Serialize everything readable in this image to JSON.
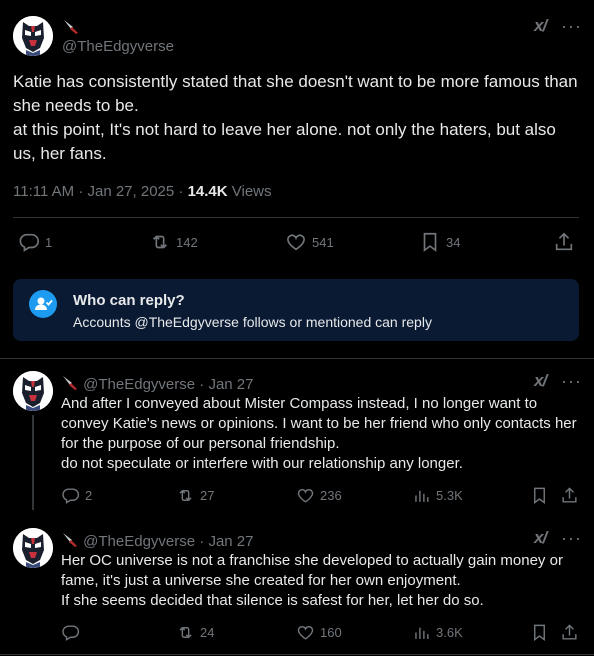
{
  "main_post": {
    "handle": "@TheEdgyverse",
    "text": "Katie has consistently stated that she doesn't want to be more famous than she needs to be.\nat this point, It's not hard to leave her alone. not only the haters, but also us, her fans.",
    "timestamp": "11:11 AM · Jan 27, 2025 · ",
    "views_count": "14.4K",
    "views_label": " Views",
    "replies": "1",
    "reposts": "142",
    "likes": "541",
    "bookmarks": "34",
    "brand_mark": "x/",
    "more": "···"
  },
  "who_can_reply": {
    "title": "Who can reply?",
    "text": "Accounts @TheEdgyverse follows or mentioned can reply"
  },
  "replies": [
    {
      "handle": "@TheEdgyverse",
      "date": " · Jan 27",
      "text": "And after I conveyed about Mister Compass instead, I no longer want to convey Katie's news or opinions. I want to be her friend who only contacts her for the purpose of our personal friendship.\ndo not speculate or interfere with our relationship any longer.",
      "replies": "2",
      "reposts": "27",
      "likes": "236",
      "views": "5.3K"
    },
    {
      "handle": "@TheEdgyverse",
      "date": " · Jan 27",
      "text": "Her OC universe is not a franchise she developed to actually gain money or fame, it's just a universe she created for her own enjoyment.\nIf she seems decided that silence is safest for her, let her do so.",
      "replies": "",
      "reposts": "24",
      "likes": "160",
      "views": "3.6K"
    }
  ],
  "icons": {
    "reply": "reply-icon",
    "repost": "repost-icon",
    "like": "heart-icon",
    "bookmark": "bookmark-icon",
    "share": "share-icon",
    "views": "views-icon",
    "knife": "knife-emoji-icon",
    "person_check": "person-check-icon"
  },
  "colors": {
    "background": "#000000",
    "text": "#e7e9ea",
    "muted": "#71767b",
    "accent": "#1d9bf0",
    "notice_bg": "#0a1a33",
    "divider": "#2f3336"
  }
}
